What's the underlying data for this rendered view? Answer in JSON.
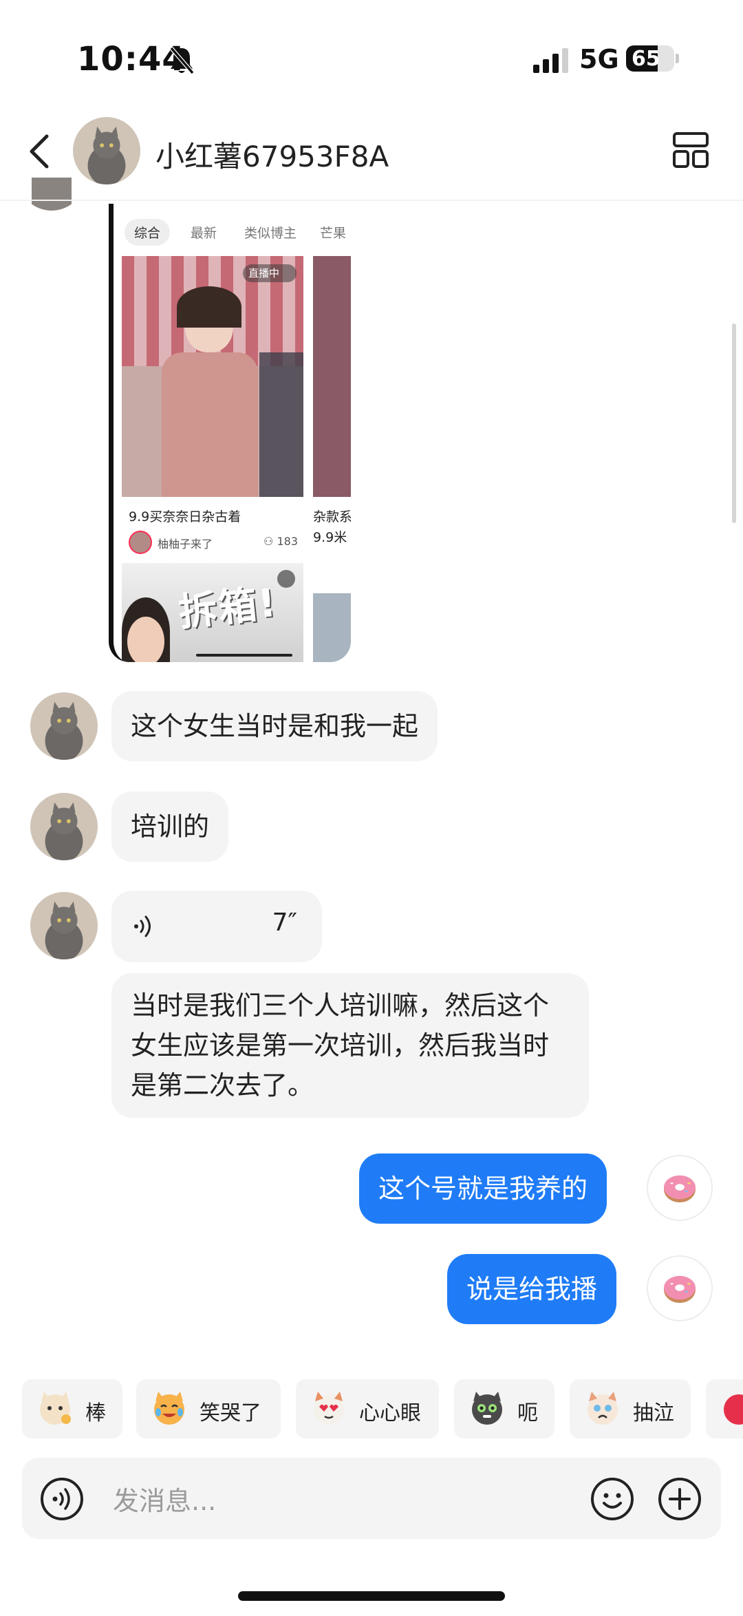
{
  "status_bar": {
    "time": "10:44",
    "network": "5G",
    "battery": "65"
  },
  "header": {
    "title": "小红薯67953F8A"
  },
  "shared_post": {
    "tabs": [
      "综合",
      "最新",
      "类似博主",
      "芒果"
    ],
    "live_badge": "直播中",
    "card_title": "9.9买奈奈日杂古着",
    "author": "柚柚子来了",
    "viewer_count": "183",
    "overlay_text": "拆箱!",
    "second_column_title": "杂款系",
    "second_column_sub": "9.9米"
  },
  "messages": [
    {
      "from": "other",
      "text": "这个女生当时是和我一起"
    },
    {
      "from": "other",
      "text": "培训的"
    },
    {
      "from": "other",
      "type": "voice",
      "duration": "7″"
    },
    {
      "from": "other",
      "text": "当时是我们三个人培训嘛，然后这个女生应该是第一次培训，然后我当时是第二次去了。"
    },
    {
      "from": "me",
      "text": "这个号就是我养的"
    },
    {
      "from": "me",
      "text": "说是给我播"
    }
  ],
  "quick_reactions": [
    "棒",
    "笑哭了",
    "心心眼",
    "呃",
    "抽泣"
  ],
  "input": {
    "placeholder": "发消息..."
  }
}
